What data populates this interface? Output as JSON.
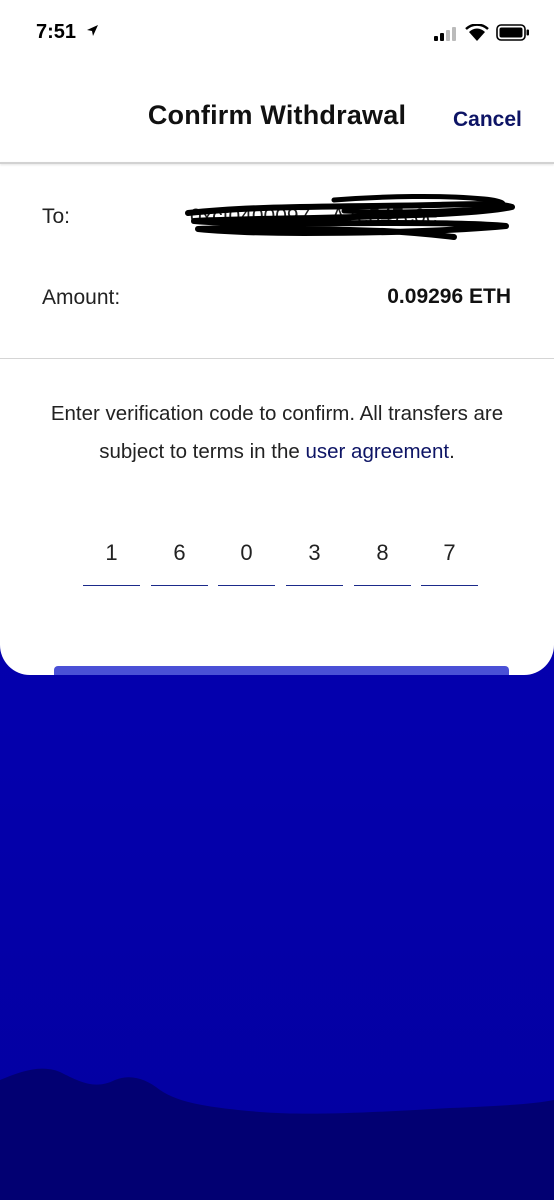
{
  "status_bar": {
    "time": "7:51"
  },
  "header": {
    "title": "Confirm Withdrawal",
    "cancel_label": "Cancel"
  },
  "details": {
    "to_label": "To:",
    "to_value": "0xcf0400097…A7e547c0e",
    "amount_label": "Amount:",
    "amount_value": "0.09296 ETH"
  },
  "instructions": {
    "text": "Enter verification code to confirm. All transfers are subject to terms in the ",
    "link_text": "user agreement",
    "suffix": "."
  },
  "verification_code": [
    "1",
    "6",
    "0",
    "3",
    "8",
    "7"
  ],
  "colors": {
    "accent": "#0d1465",
    "background": "#0400ad",
    "button": "#4a50d6"
  }
}
